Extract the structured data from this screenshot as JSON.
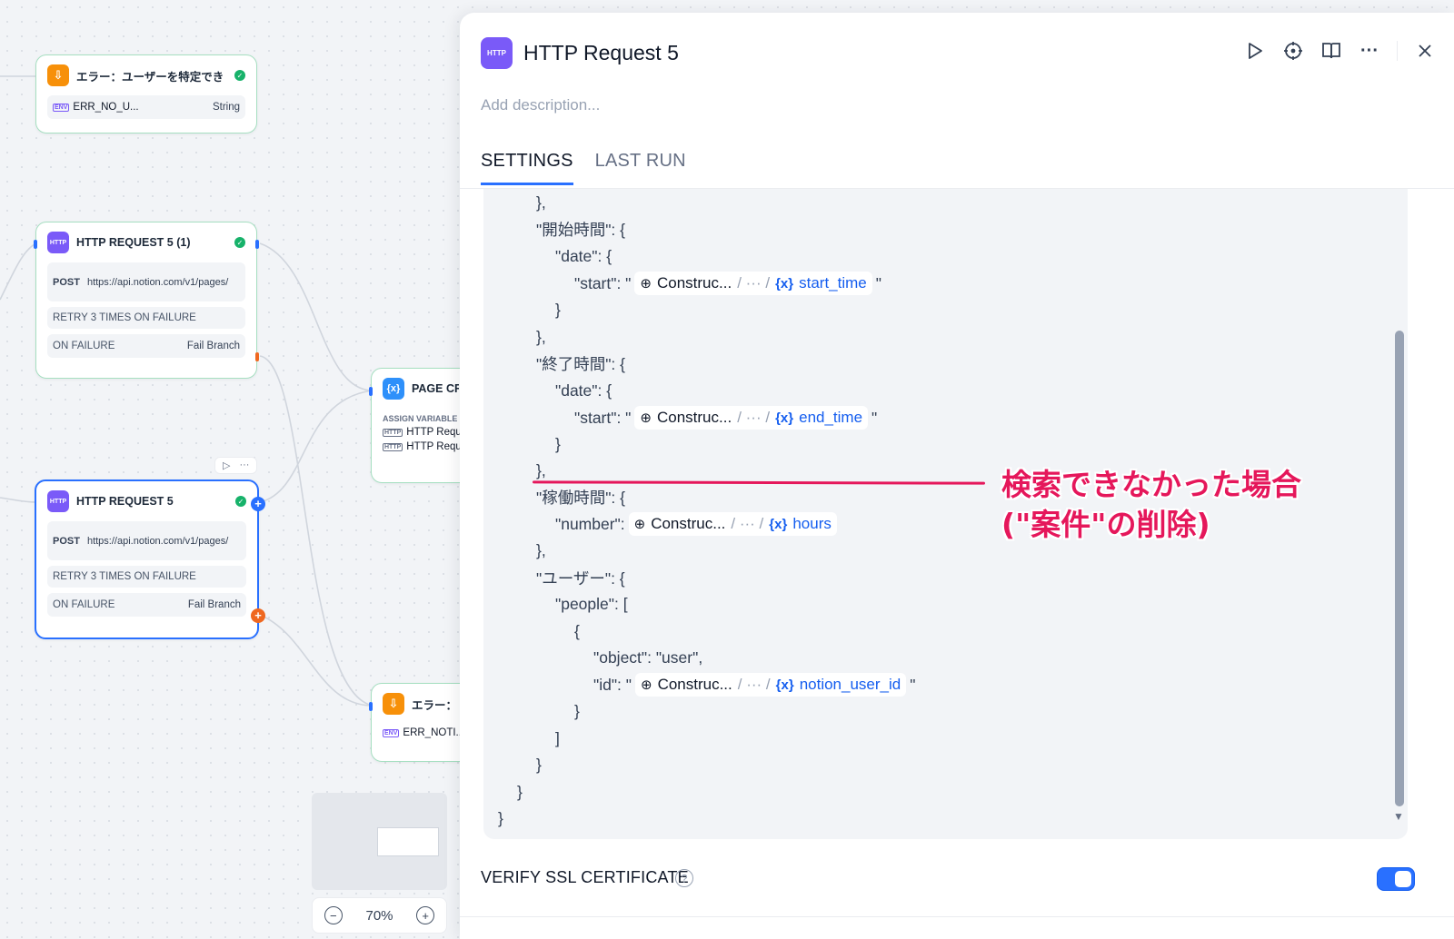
{
  "canvas": {
    "node_error_user": {
      "title": "エラー：ユーザーを特定でき",
      "var_name": "ERR_NO_U...",
      "var_type": "String",
      "env_tag": "ENV"
    },
    "node_http_1": {
      "icon_text": "HTTP",
      "title": "HTTP REQUEST 5 (1)",
      "method": "POST",
      "url": "https://api.notion.com/v1/pages/",
      "retry": "RETRY 3 TIMES ON FAILURE",
      "on_failure_label": "ON FAILURE",
      "on_failure_value": "Fail Branch"
    },
    "node_http_2": {
      "icon_text": "HTTP",
      "title": "HTTP REQUEST 5",
      "method": "POST",
      "url": "https://api.notion.com/v1/pages/",
      "retry": "RETRY 3 TIMES ON FAILURE",
      "on_failure_label": "ON FAILURE",
      "on_failure_value": "Fail Branch"
    },
    "node_page_create": {
      "icon_text": "{x}",
      "title": "PAGE CR",
      "section_label": "ASSIGN VARIABLE",
      "items": [
        "HTTP Requ",
        "HTTP Requ"
      ],
      "item_tag": "HTTP"
    },
    "node_error_notion": {
      "title": "エラー：",
      "var_name": "ERR_NOTI...",
      "env_tag": "ENV"
    },
    "zoom": {
      "minus": "−",
      "level": "70%",
      "plus": "+"
    }
  },
  "panel": {
    "icon_text": "HTTP",
    "title": "HTTP Request 5",
    "description_placeholder": "Add description...",
    "tabs": [
      "SETTINGS",
      "LAST RUN"
    ],
    "active_tab": "SETTINGS",
    "code": {
      "l1": "},",
      "l2": "\"開始時間\": {",
      "l3": "\"date\": {",
      "l4_pre": "\"start\": \"",
      "l4_var": "start_time",
      "l4_post": "\"",
      "l5": "}",
      "l6": "},",
      "l7": "\"終了時間\": {",
      "l8": "\"date\": {",
      "l9_pre": "\"start\": \"",
      "l9_var": "end_time",
      "l9_post": "\"",
      "l10": "}",
      "l11": "},",
      "l12": "\"稼働時間\": {",
      "l13_pre": "\"number\":",
      "l13_var": "hours",
      "l14": "},",
      "l15": "\"ユーザー\": {",
      "l16": "\"people\": [",
      "l17": "{",
      "l18": "\"object\": \"user\",",
      "l19_pre": "\"id\": \"",
      "l19_var": "notion_user_id",
      "l19_post": "\"",
      "l20": "}",
      "l21": "]",
      "l22": "}",
      "l23": "}",
      "l24": "}",
      "pill_node": "Construc...",
      "pill_sep": "/ ··· /",
      "pill_x": "{x}"
    },
    "verify_ssl_label": "VERIFY SSL CERTIFICATE",
    "verify_ssl_enabled": true
  },
  "annotation": {
    "text": "検索できなかった場合\n(\"案件\"の削除)",
    "color": "#e5175b"
  },
  "colors": {
    "accent": "#2970ff",
    "http": "#7a5af8",
    "end": "#f79009",
    "success": "#17b26a"
  }
}
